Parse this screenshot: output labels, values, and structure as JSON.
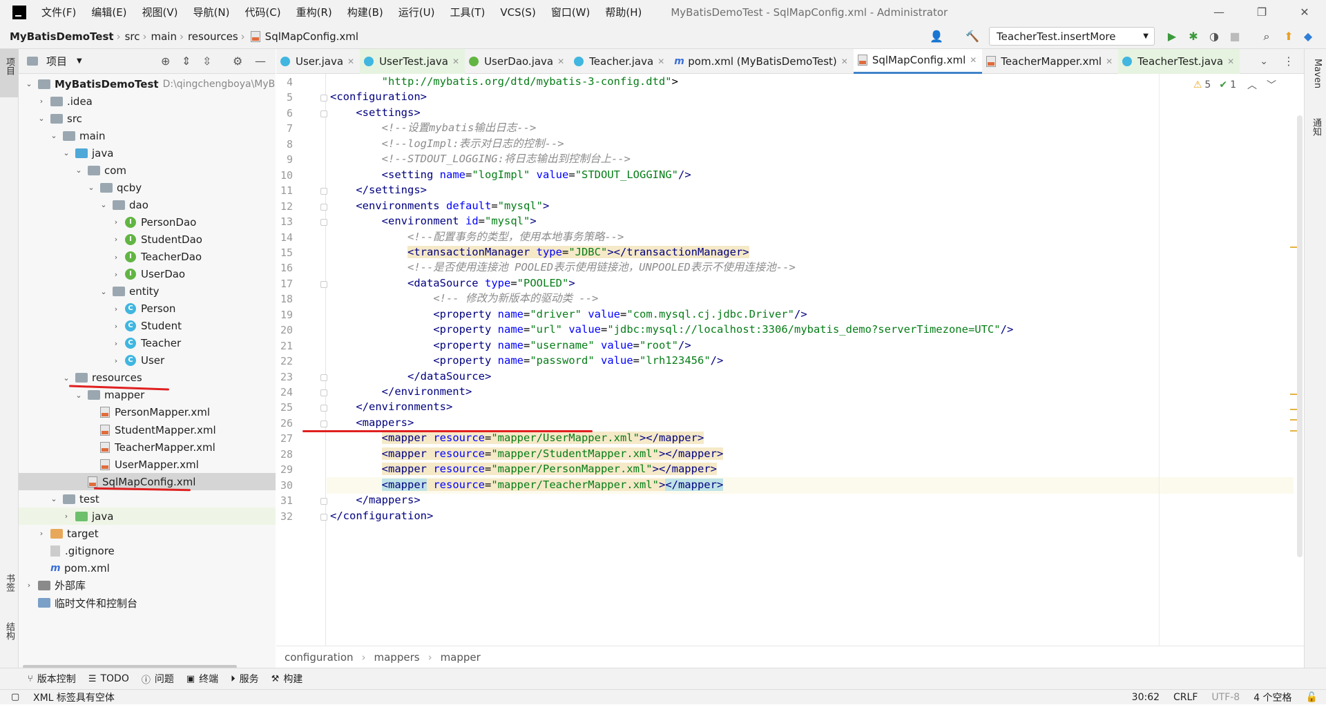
{
  "window": {
    "app_title": "MyBatisDemoTest - SqlMapConfig.xml - Administrator",
    "menu": [
      "文件(F)",
      "编辑(E)",
      "视图(V)",
      "导航(N)",
      "代码(C)",
      "重构(R)",
      "构建(B)",
      "运行(U)",
      "工具(T)",
      "VCS(S)",
      "窗口(W)",
      "帮助(H)"
    ]
  },
  "navbar": {
    "breadcrumbs": [
      "MyBatisDemoTest",
      "src",
      "main",
      "resources",
      "SqlMapConfig.xml"
    ],
    "run_config": "TeacherTest.insertMore"
  },
  "left_stripe": {
    "project_tab": "项目",
    "bookmarks_tab": "书签",
    "structure_tab": "结构"
  },
  "right_stripe": {
    "maven_tab": "Maven",
    "notify_tab": "通知"
  },
  "project_panel": {
    "title": "项目",
    "tree": [
      {
        "label": "MyBatisDemoTest",
        "path": "D:\\qingchengboya\\MyB",
        "indent": 0,
        "chev": "v",
        "icon": "folder",
        "bold": true
      },
      {
        "label": ".idea",
        "indent": 1,
        "chev": ">",
        "icon": "folder"
      },
      {
        "label": "src",
        "indent": 1,
        "chev": "v",
        "icon": "folder"
      },
      {
        "label": "main",
        "indent": 2,
        "chev": "v",
        "icon": "folder"
      },
      {
        "label": "java",
        "indent": 3,
        "chev": "v",
        "icon": "folder-blue"
      },
      {
        "label": "com",
        "indent": 4,
        "chev": "v",
        "icon": "folder"
      },
      {
        "label": "qcby",
        "indent": 5,
        "chev": "v",
        "icon": "folder"
      },
      {
        "label": "dao",
        "indent": 6,
        "chev": "v",
        "icon": "folder"
      },
      {
        "label": "PersonDao",
        "indent": 7,
        "chev": ">",
        "icon": "interface"
      },
      {
        "label": "StudentDao",
        "indent": 7,
        "chev": ">",
        "icon": "interface"
      },
      {
        "label": "TeacherDao",
        "indent": 7,
        "chev": ">",
        "icon": "interface"
      },
      {
        "label": "UserDao",
        "indent": 7,
        "chev": ">",
        "icon": "interface"
      },
      {
        "label": "entity",
        "indent": 6,
        "chev": "v",
        "icon": "folder"
      },
      {
        "label": "Person",
        "indent": 7,
        "chev": ">",
        "icon": "class"
      },
      {
        "label": "Student",
        "indent": 7,
        "chev": ">",
        "icon": "class"
      },
      {
        "label": "Teacher",
        "indent": 7,
        "chev": ">",
        "icon": "class"
      },
      {
        "label": "User",
        "indent": 7,
        "chev": ">",
        "icon": "class"
      },
      {
        "label": "resources",
        "indent": 3,
        "chev": "v",
        "icon": "folder-res"
      },
      {
        "label": "mapper",
        "indent": 4,
        "chev": "v",
        "icon": "folder"
      },
      {
        "label": "PersonMapper.xml",
        "indent": 5,
        "chev": "",
        "icon": "xml"
      },
      {
        "label": "StudentMapper.xml",
        "indent": 5,
        "chev": "",
        "icon": "xml"
      },
      {
        "label": "TeacherMapper.xml",
        "indent": 5,
        "chev": "",
        "icon": "xml"
      },
      {
        "label": "UserMapper.xml",
        "indent": 5,
        "chev": "",
        "icon": "xml"
      },
      {
        "label": "SqlMapConfig.xml",
        "indent": 4,
        "chev": "",
        "icon": "xml",
        "selected": true
      },
      {
        "label": "test",
        "indent": 2,
        "chev": "v",
        "icon": "folder"
      },
      {
        "label": "java",
        "indent": 3,
        "chev": ">",
        "icon": "folder-green",
        "highlight": true
      },
      {
        "label": "target",
        "indent": 1,
        "chev": ">",
        "icon": "folder-orange"
      },
      {
        "label": ".gitignore",
        "indent": 1,
        "chev": "",
        "icon": "git"
      },
      {
        "label": "pom.xml",
        "indent": 1,
        "chev": "",
        "icon": "maven"
      },
      {
        "label": "外部库",
        "indent": 0,
        "chev": ">",
        "icon": "library"
      },
      {
        "label": "临时文件和控制台",
        "indent": 0,
        "chev": "",
        "icon": "scratch"
      }
    ]
  },
  "tabs": [
    {
      "label": "User.java",
      "icon": "class",
      "active": false
    },
    {
      "label": "UserTest.java",
      "icon": "class",
      "active": false,
      "green": true
    },
    {
      "label": "UserDao.java",
      "icon": "interface",
      "active": false
    },
    {
      "label": "Teacher.java",
      "icon": "class",
      "active": false
    },
    {
      "label": "pom.xml (MyBatisDemoTest)",
      "icon": "maven",
      "active": false
    },
    {
      "label": "SqlMapConfig.xml",
      "icon": "xml",
      "active": true
    },
    {
      "label": "TeacherMapper.xml",
      "icon": "xml",
      "active": false
    },
    {
      "label": "TeacherTest.java",
      "icon": "class",
      "active": false,
      "green": true
    }
  ],
  "inspections": {
    "warnings": "5",
    "weak_warnings": "1"
  },
  "code_lines": [
    {
      "n": "4",
      "html": "        <span class=\"s\">\"http://mybatis.org/dtd/mybatis-3-config.dtd\"</span>&gt;"
    },
    {
      "n": "5",
      "html": "<span class=\"t\">&lt;configuration&gt;</span>"
    },
    {
      "n": "6",
      "html": "    <span class=\"t\">&lt;settings&gt;</span>"
    },
    {
      "n": "7",
      "html": "        <span class=\"c\">&lt;!--设置mybatis输出日志--&gt;</span>"
    },
    {
      "n": "8",
      "html": "        <span class=\"c\">&lt;!--logImpl:表示对日志的控制--&gt;</span>"
    },
    {
      "n": "9",
      "html": "        <span class=\"c\">&lt;!--STDOUT_LOGGING:将日志输出到控制台上--&gt;</span>"
    },
    {
      "n": "10",
      "html": "        <span class=\"t\">&lt;setting</span> <span class=\"a\">name</span>=<span class=\"s\">\"logImpl\"</span> <span class=\"a\">value</span>=<span class=\"s\">\"STDOUT_LOGGING\"</span><span class=\"t\">/&gt;</span>"
    },
    {
      "n": "11",
      "html": "    <span class=\"t\">&lt;/settings&gt;</span>"
    },
    {
      "n": "12",
      "html": "    <span class=\"t\">&lt;environments</span> <span class=\"a\">default</span>=<span class=\"s\">\"mysql\"</span><span class=\"t\">&gt;</span>"
    },
    {
      "n": "13",
      "html": "        <span class=\"t\">&lt;environment</span> <span class=\"a\">id</span>=<span class=\"s\">\"mysql\"</span><span class=\"t\">&gt;</span>"
    },
    {
      "n": "14",
      "html": "            <span class=\"c\">&lt;!--配置事务的类型，使用本地事务策略--&gt;</span>"
    },
    {
      "n": "15",
      "html": "            <span class=\"tagbg\"><span class=\"t\">&lt;transactionManager</span> <span class=\"a\">type</span>=<span class=\"s\">\"JDBC\"</span><span class=\"t\">&gt;&lt;/transactionManager&gt;</span></span>"
    },
    {
      "n": "16",
      "html": "            <span class=\"c\">&lt;!--是否使用连接池 POOLED表示使用链接池，UNPOOLED表示不使用连接池--&gt;</span>"
    },
    {
      "n": "17",
      "html": "            <span class=\"t\">&lt;dataSource</span> <span class=\"a\">type</span>=<span class=\"s\">\"POOLED\"</span><span class=\"t\">&gt;</span>"
    },
    {
      "n": "18",
      "html": "                <span class=\"c\">&lt;!-- 修改为新版本的驱动类 --&gt;</span>"
    },
    {
      "n": "19",
      "html": "                <span class=\"t\">&lt;property</span> <span class=\"a\">name</span>=<span class=\"s\">\"driver\"</span> <span class=\"a\">value</span>=<span class=\"s\">\"com.mysql.cj.jdbc.Driver\"</span><span class=\"t\">/&gt;</span>"
    },
    {
      "n": "20",
      "html": "                <span class=\"t\">&lt;property</span> <span class=\"a\">name</span>=<span class=\"s\">\"url\"</span> <span class=\"a\">value</span>=<span class=\"s\">\"jdbc:mysql://localhost:3306/mybatis_demo?serverTimezone=UTC\"</span><span class=\"t\">/&gt;</span>"
    },
    {
      "n": "21",
      "html": "                <span class=\"t\">&lt;property</span> <span class=\"a\">name</span>=<span class=\"s\">\"username\"</span> <span class=\"a\">value</span>=<span class=\"s\">\"root\"</span><span class=\"t\">/&gt;</span>"
    },
    {
      "n": "22",
      "html": "                <span class=\"t\">&lt;property</span> <span class=\"a\">name</span>=<span class=\"s\">\"password\"</span> <span class=\"a\">value</span>=<span class=\"s\">\"lrh123456\"</span><span class=\"t\">/&gt;</span>"
    },
    {
      "n": "23",
      "html": "            <span class=\"t\">&lt;/dataSource&gt;</span>"
    },
    {
      "n": "24",
      "html": "        <span class=\"t\">&lt;/environment&gt;</span>"
    },
    {
      "n": "25",
      "html": "    <span class=\"t\">&lt;/environments&gt;</span>"
    },
    {
      "n": "26",
      "html": "    <span class=\"t\">&lt;mappers&gt;</span>"
    },
    {
      "n": "27",
      "html": "        <span class=\"tagbg\"><span class=\"t\">&lt;mapper</span> <span class=\"a\">resource</span>=<span class=\"s\">\"mapper/UserMapper.xml\"</span><span class=\"t\">&gt;&lt;/mapper&gt;</span></span>"
    },
    {
      "n": "28",
      "html": "        <span class=\"tagbg\"><span class=\"t\">&lt;mapper</span> <span class=\"a\">resource</span>=<span class=\"s\">\"mapper/StudentMapper.xml\"</span><span class=\"t\">&gt;&lt;/mapper&gt;</span></span>"
    },
    {
      "n": "29",
      "html": "        <span class=\"tagbg\"><span class=\"t\">&lt;mapper</span> <span class=\"a\">resource</span>=<span class=\"s\">\"mapper/PersonMapper.xml\"</span><span class=\"t\">&gt;&lt;/mapper&gt;</span></span>"
    },
    {
      "n": "30",
      "html": "        <span class=\"tagbg\"><span class=\"tagbg2\"><span class=\"t\">&lt;mapper</span></span> <span class=\"a\">resource</span>=<span class=\"s\">\"mapper/TeacherMapper.xml\"</span><span class=\"t\">&gt;</span><span class=\"tagbg2\"><span class=\"t\">&lt;/mapper&gt;</span></span></span>"
    },
    {
      "n": "31",
      "html": "    <span class=\"t\">&lt;/mappers&gt;</span>"
    },
    {
      "n": "32",
      "html": "<span class=\"t\">&lt;/configuration&gt;</span>"
    }
  ],
  "code_crumbs": [
    "configuration",
    "mappers",
    "mapper"
  ],
  "toolwindows": [
    "版本控制",
    "TODO",
    "问题",
    "终端",
    "服务",
    "构建"
  ],
  "status": {
    "message": "XML 标签具有空体",
    "position": "30:62",
    "line_sep": "CRLF",
    "encoding": "UTF-8",
    "indent": "4 个空格"
  }
}
